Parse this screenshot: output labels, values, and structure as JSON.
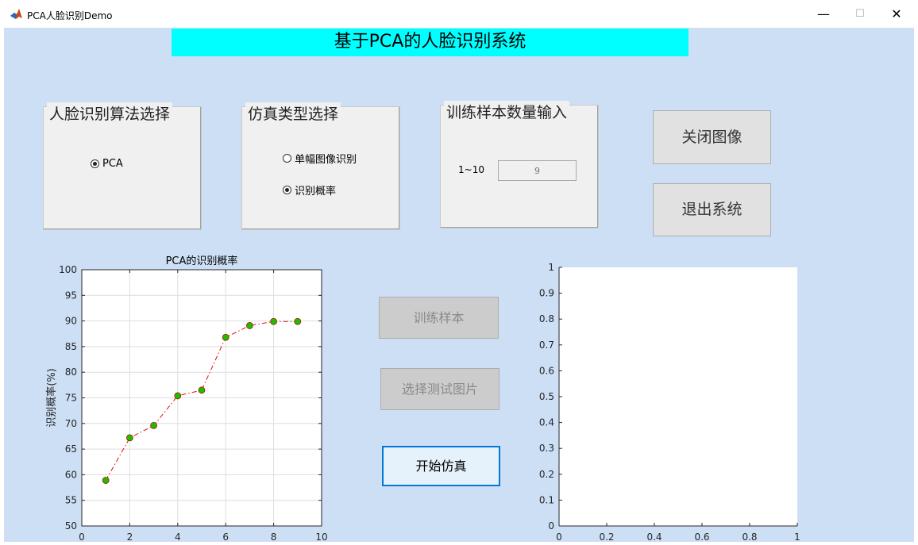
{
  "window": {
    "title": "PCA人脸识别Demo",
    "minimize_glyph": "—",
    "maximize_glyph": "☐",
    "close_glyph": "✕",
    "icon": "matlab-logo-icon"
  },
  "header": {
    "title": "基于PCA的人脸识别系统"
  },
  "panels": {
    "algorithm": {
      "title": "人脸识别算法选择",
      "option": "PCA",
      "selected": true
    },
    "sim_type": {
      "title": "仿真类型选择",
      "options": [
        {
          "label": "单幅图像识别",
          "selected": false
        },
        {
          "label": "识别概率",
          "selected": true
        }
      ]
    },
    "samples": {
      "title": "训练样本数量输入",
      "range_label": "1~10",
      "value": "9"
    }
  },
  "buttons": {
    "close_image": "关闭图像",
    "exit_system": "退出系统",
    "train_samples": "训练样本",
    "select_test_image": "选择测试图片",
    "start_simulation": "开始仿真"
  },
  "colors": {
    "background": "#cddff5",
    "heading": "#00ffff",
    "line": "#e01010",
    "marker": "#22bb00"
  },
  "chart_data": [
    {
      "type": "line",
      "title": "PCA的识别概率",
      "xlabel": "",
      "ylabel": "识别概率(%)",
      "xlim": [
        0,
        10
      ],
      "ylim": [
        50,
        100
      ],
      "xticks": [
        0,
        2,
        4,
        6,
        8,
        10
      ],
      "yticks": [
        50,
        55,
        60,
        65,
        70,
        75,
        80,
        85,
        90,
        95,
        100
      ],
      "grid": true,
      "series": [
        {
          "x": [
            1,
            2,
            3,
            4,
            5,
            6,
            7,
            8,
            9
          ],
          "y": [
            58.9,
            67.2,
            69.6,
            75.4,
            76.5,
            86.8,
            89.1,
            89.9,
            89.9
          ]
        }
      ]
    },
    {
      "type": "scatter",
      "title": "",
      "xlim": [
        0,
        1
      ],
      "ylim": [
        0,
        1
      ],
      "xticks": [
        "0",
        "0.2",
        "0.4",
        "0.6",
        "0.8",
        "1"
      ],
      "yticks": [
        "0",
        "0.1",
        "0.2",
        "0.3",
        "0.4",
        "0.5",
        "0.6",
        "0.7",
        "0.8",
        "0.9",
        "1"
      ],
      "grid": false,
      "series": []
    }
  ]
}
